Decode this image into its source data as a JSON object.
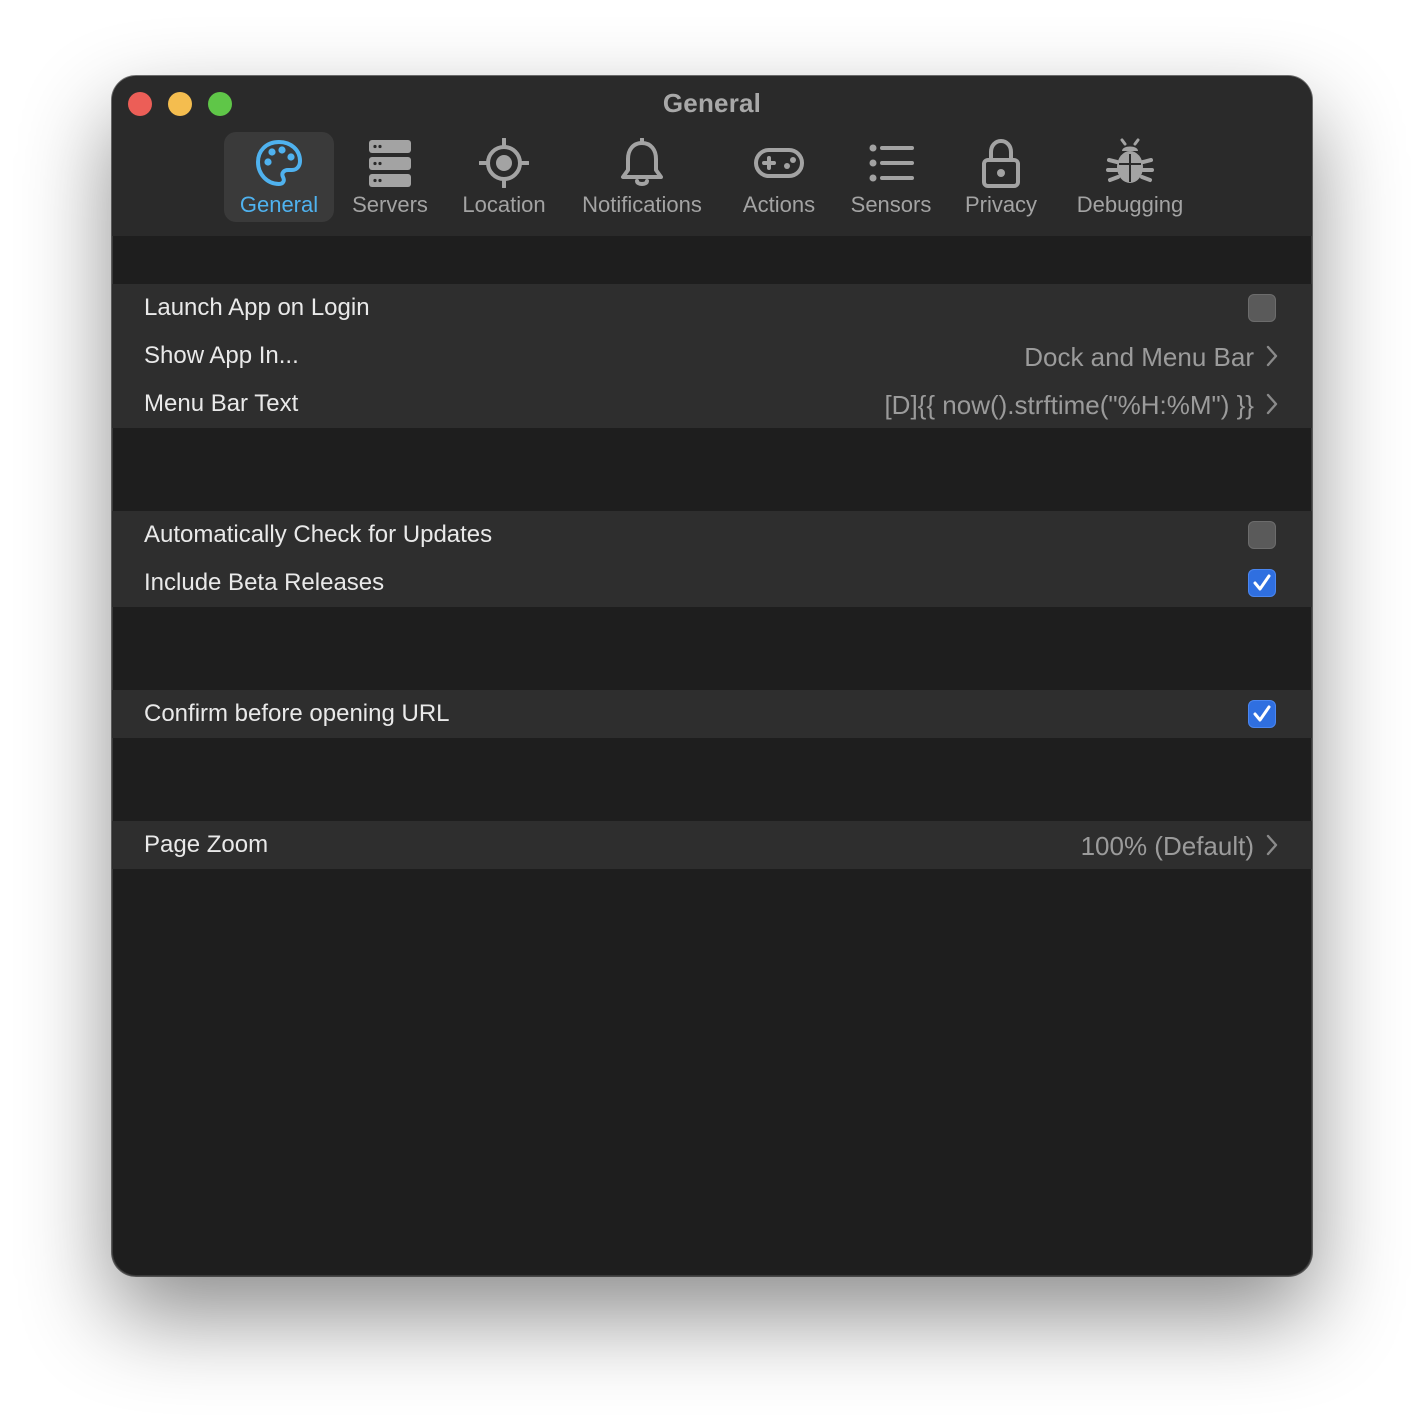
{
  "window": {
    "title": "General"
  },
  "tabs": [
    {
      "label": "General",
      "icon": "palette-icon",
      "active": true
    },
    {
      "label": "Servers",
      "icon": "servers-icon",
      "active": false
    },
    {
      "label": "Location",
      "icon": "location-icon",
      "active": false
    },
    {
      "label": "Notifications",
      "icon": "bell-icon",
      "active": false
    },
    {
      "label": "Actions",
      "icon": "gamepad-icon",
      "active": false
    },
    {
      "label": "Sensors",
      "icon": "list-icon",
      "active": false
    },
    {
      "label": "Privacy",
      "icon": "lock-icon",
      "active": false
    },
    {
      "label": "Debugging",
      "icon": "bug-icon",
      "active": false
    }
  ],
  "sections": {
    "app": {
      "launch_on_login": {
        "label": "Launch App on Login",
        "checked": false
      },
      "show_app_in": {
        "label": "Show App In...",
        "value": "Dock and Menu Bar"
      },
      "menu_bar_text": {
        "label": "Menu Bar Text",
        "value": "[D]{{ now().strftime(\"%H:%M\") }}"
      }
    },
    "updates": {
      "auto_check": {
        "label": "Automatically Check for Updates",
        "checked": false
      },
      "include_beta": {
        "label": "Include Beta Releases",
        "checked": true
      }
    },
    "urls": {
      "confirm_open": {
        "label": "Confirm before opening URL",
        "checked": true
      }
    },
    "zoom": {
      "page_zoom": {
        "label": "Page Zoom",
        "value": "100% (Default)"
      }
    }
  },
  "colors": {
    "accent": "#4fb2ef",
    "checkbox_on": "#2f6fe0",
    "window_bg": "#1e1e1e",
    "row_bg": "#2e2e2e"
  }
}
